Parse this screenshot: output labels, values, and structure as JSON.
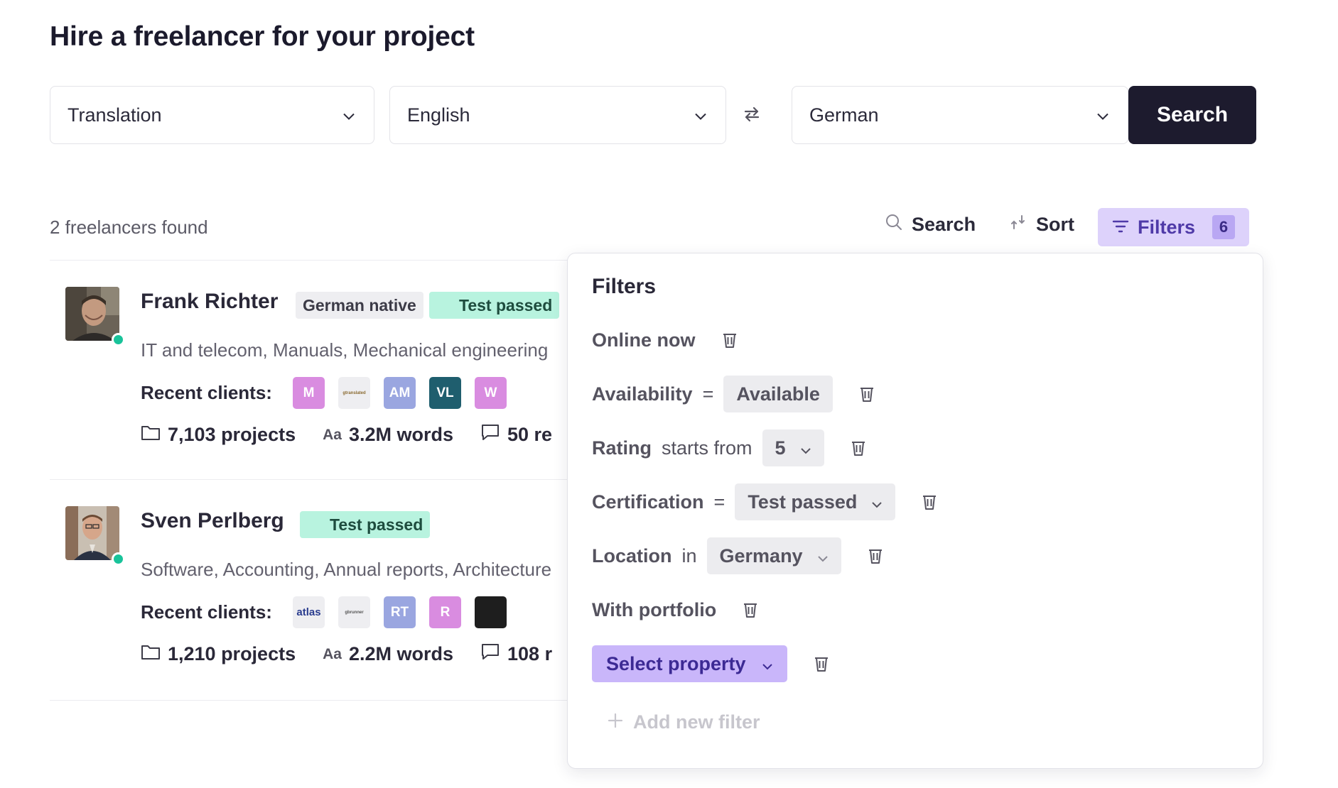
{
  "page": {
    "title": "Hire a freelancer for your project"
  },
  "search_bar": {
    "service": "Translation",
    "source_language": "English",
    "target_language": "German",
    "search_label": "Search"
  },
  "results": {
    "count_text": "2 freelancers found",
    "toolbar": {
      "search_label": "Search",
      "sort_label": "Sort",
      "filters_label": "Filters",
      "filters_count": "6"
    }
  },
  "freelancers": [
    {
      "name": "Frank Richter",
      "badges": [
        "German native",
        "Test passed"
      ],
      "skills": "IT and telecom, Manuals, Mechanical engineering",
      "recent_clients_label": "Recent clients:",
      "clients": [
        {
          "label": "M",
          "color": "#d98ce0"
        },
        {
          "label": "gtranslated",
          "color": "#eeeef1"
        },
        {
          "label": "AM",
          "color": "#9aa6e0"
        },
        {
          "label": "VL",
          "color": "#1f5e6e"
        },
        {
          "label": "W",
          "color": "#d98ce0"
        }
      ],
      "projects": "7,103 projects",
      "words": "3.2M words",
      "reviews": "50 re"
    },
    {
      "name": "Sven Perlberg",
      "badges": [
        "Test passed"
      ],
      "skills": "Software, Accounting, Annual reports, Architecture",
      "recent_clients_label": "Recent clients:",
      "clients": [
        {
          "label": "atlas",
          "color": "#eeeef1"
        },
        {
          "label": "gbrunner",
          "color": "#eeeef1"
        },
        {
          "label": "RT",
          "color": "#9aa6e0"
        },
        {
          "label": "R",
          "color": "#d98ce0"
        },
        {
          "label": "",
          "color": "#1e1e1e"
        }
      ],
      "projects": "1,210 projects",
      "words": "2.2M words",
      "reviews": "108 r"
    }
  ],
  "filters_panel": {
    "title": "Filters",
    "rows": [
      {
        "property": "Online now"
      },
      {
        "property": "Availability",
        "operator": "=",
        "value": "Available"
      },
      {
        "property": "Rating",
        "operator": "starts from",
        "value": "5"
      },
      {
        "property": "Certification",
        "operator": "=",
        "value": "Test passed"
      },
      {
        "property": "Location",
        "operator": "in",
        "value": "Germany"
      },
      {
        "property": "With portfolio"
      },
      {
        "property": "Select property"
      }
    ],
    "add_filter_label": "Add new filter"
  },
  "colors": {
    "primary_dark": "#1d1b2e",
    "filters_bg": "#ddd2fb",
    "accent_purple": "#c9b6fa",
    "test_passed_green": "#b8f3df",
    "online_green": "#19c39a"
  }
}
